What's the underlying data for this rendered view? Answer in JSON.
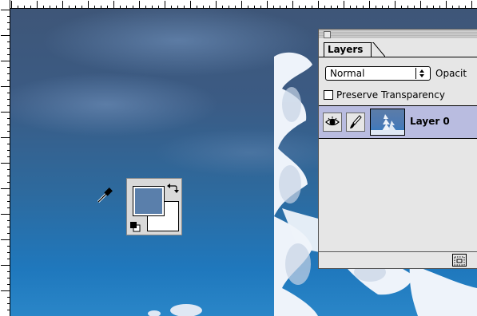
{
  "layers_panel": {
    "tab_label": "Layers",
    "blend_mode": "Normal",
    "opacity_label": "Opacit",
    "preserve_transparency_label": "Preserve Transparency",
    "preserve_transparency_checked": false,
    "layers": [
      {
        "name": "Layer 0",
        "visible": true,
        "selected": true
      }
    ]
  },
  "color_swatches": {
    "foreground": "#5a7fab",
    "background": "#ffffff"
  },
  "tool": {
    "active": "eyedropper-icon"
  }
}
